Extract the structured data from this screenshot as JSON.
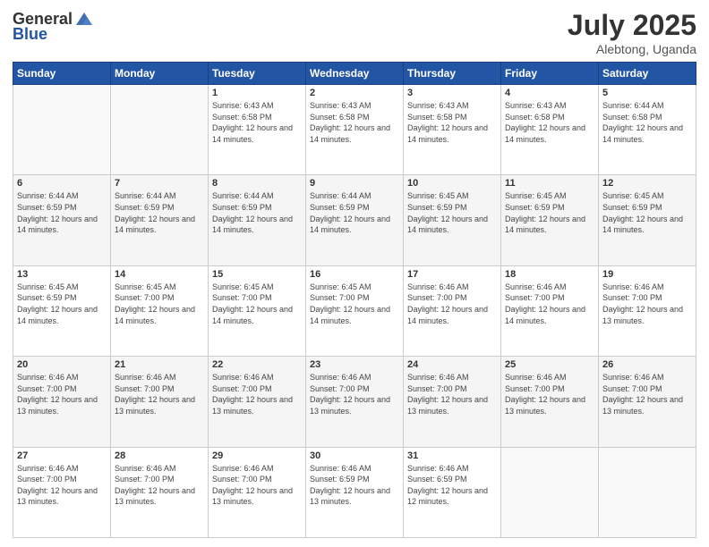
{
  "header": {
    "logo_general": "General",
    "logo_blue": "Blue",
    "month": "July 2025",
    "location": "Alebtong, Uganda"
  },
  "weekdays": [
    "Sunday",
    "Monday",
    "Tuesday",
    "Wednesday",
    "Thursday",
    "Friday",
    "Saturday"
  ],
  "weeks": [
    [
      {
        "day": "",
        "info": ""
      },
      {
        "day": "",
        "info": ""
      },
      {
        "day": "1",
        "info": "Sunrise: 6:43 AM\nSunset: 6:58 PM\nDaylight: 12 hours and 14 minutes."
      },
      {
        "day": "2",
        "info": "Sunrise: 6:43 AM\nSunset: 6:58 PM\nDaylight: 12 hours and 14 minutes."
      },
      {
        "day": "3",
        "info": "Sunrise: 6:43 AM\nSunset: 6:58 PM\nDaylight: 12 hours and 14 minutes."
      },
      {
        "day": "4",
        "info": "Sunrise: 6:43 AM\nSunset: 6:58 PM\nDaylight: 12 hours and 14 minutes."
      },
      {
        "day": "5",
        "info": "Sunrise: 6:44 AM\nSunset: 6:58 PM\nDaylight: 12 hours and 14 minutes."
      }
    ],
    [
      {
        "day": "6",
        "info": "Sunrise: 6:44 AM\nSunset: 6:59 PM\nDaylight: 12 hours and 14 minutes."
      },
      {
        "day": "7",
        "info": "Sunrise: 6:44 AM\nSunset: 6:59 PM\nDaylight: 12 hours and 14 minutes."
      },
      {
        "day": "8",
        "info": "Sunrise: 6:44 AM\nSunset: 6:59 PM\nDaylight: 12 hours and 14 minutes."
      },
      {
        "day": "9",
        "info": "Sunrise: 6:44 AM\nSunset: 6:59 PM\nDaylight: 12 hours and 14 minutes."
      },
      {
        "day": "10",
        "info": "Sunrise: 6:45 AM\nSunset: 6:59 PM\nDaylight: 12 hours and 14 minutes."
      },
      {
        "day": "11",
        "info": "Sunrise: 6:45 AM\nSunset: 6:59 PM\nDaylight: 12 hours and 14 minutes."
      },
      {
        "day": "12",
        "info": "Sunrise: 6:45 AM\nSunset: 6:59 PM\nDaylight: 12 hours and 14 minutes."
      }
    ],
    [
      {
        "day": "13",
        "info": "Sunrise: 6:45 AM\nSunset: 6:59 PM\nDaylight: 12 hours and 14 minutes."
      },
      {
        "day": "14",
        "info": "Sunrise: 6:45 AM\nSunset: 7:00 PM\nDaylight: 12 hours and 14 minutes."
      },
      {
        "day": "15",
        "info": "Sunrise: 6:45 AM\nSunset: 7:00 PM\nDaylight: 12 hours and 14 minutes."
      },
      {
        "day": "16",
        "info": "Sunrise: 6:45 AM\nSunset: 7:00 PM\nDaylight: 12 hours and 14 minutes."
      },
      {
        "day": "17",
        "info": "Sunrise: 6:46 AM\nSunset: 7:00 PM\nDaylight: 12 hours and 14 minutes."
      },
      {
        "day": "18",
        "info": "Sunrise: 6:46 AM\nSunset: 7:00 PM\nDaylight: 12 hours and 14 minutes."
      },
      {
        "day": "19",
        "info": "Sunrise: 6:46 AM\nSunset: 7:00 PM\nDaylight: 12 hours and 13 minutes."
      }
    ],
    [
      {
        "day": "20",
        "info": "Sunrise: 6:46 AM\nSunset: 7:00 PM\nDaylight: 12 hours and 13 minutes."
      },
      {
        "day": "21",
        "info": "Sunrise: 6:46 AM\nSunset: 7:00 PM\nDaylight: 12 hours and 13 minutes."
      },
      {
        "day": "22",
        "info": "Sunrise: 6:46 AM\nSunset: 7:00 PM\nDaylight: 12 hours and 13 minutes."
      },
      {
        "day": "23",
        "info": "Sunrise: 6:46 AM\nSunset: 7:00 PM\nDaylight: 12 hours and 13 minutes."
      },
      {
        "day": "24",
        "info": "Sunrise: 6:46 AM\nSunset: 7:00 PM\nDaylight: 12 hours and 13 minutes."
      },
      {
        "day": "25",
        "info": "Sunrise: 6:46 AM\nSunset: 7:00 PM\nDaylight: 12 hours and 13 minutes."
      },
      {
        "day": "26",
        "info": "Sunrise: 6:46 AM\nSunset: 7:00 PM\nDaylight: 12 hours and 13 minutes."
      }
    ],
    [
      {
        "day": "27",
        "info": "Sunrise: 6:46 AM\nSunset: 7:00 PM\nDaylight: 12 hours and 13 minutes."
      },
      {
        "day": "28",
        "info": "Sunrise: 6:46 AM\nSunset: 7:00 PM\nDaylight: 12 hours and 13 minutes."
      },
      {
        "day": "29",
        "info": "Sunrise: 6:46 AM\nSunset: 7:00 PM\nDaylight: 12 hours and 13 minutes."
      },
      {
        "day": "30",
        "info": "Sunrise: 6:46 AM\nSunset: 6:59 PM\nDaylight: 12 hours and 13 minutes."
      },
      {
        "day": "31",
        "info": "Sunrise: 6:46 AM\nSunset: 6:59 PM\nDaylight: 12 hours and 12 minutes."
      },
      {
        "day": "",
        "info": ""
      },
      {
        "day": "",
        "info": ""
      }
    ]
  ]
}
